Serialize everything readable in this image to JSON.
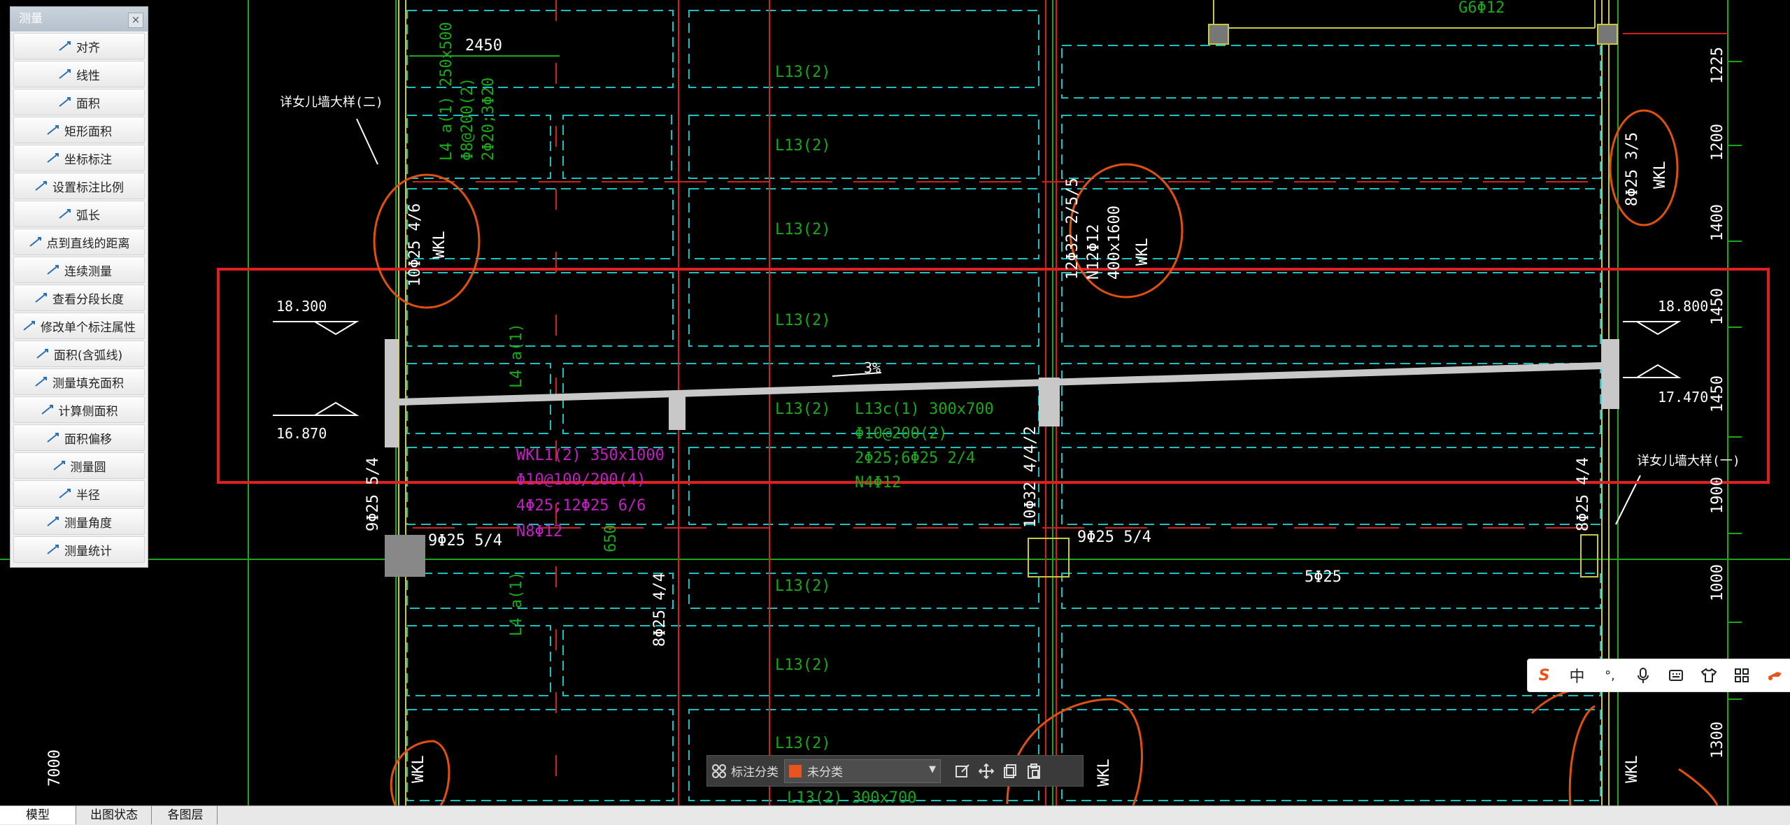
{
  "panel": {
    "title": "测量",
    "close": "×",
    "tools": [
      {
        "label": "对齐",
        "icon": "align-icon"
      },
      {
        "label": "线性",
        "icon": "linear-icon"
      },
      {
        "label": "面积",
        "icon": "area-icon"
      },
      {
        "label": "矩形面积",
        "icon": "rect-area-icon"
      },
      {
        "label": "坐标标注",
        "icon": "coordinate-icon"
      },
      {
        "label": "设置标注比例",
        "icon": "scale-icon"
      },
      {
        "label": "弧长",
        "icon": "arc-icon"
      },
      {
        "label": "点到直线的距离",
        "icon": "point-line-icon"
      },
      {
        "label": "连续测量",
        "icon": "continuous-icon"
      },
      {
        "label": "查看分段长度",
        "icon": "segment-icon"
      },
      {
        "label": "修改单个标注属性",
        "icon": "edit-dim-icon"
      },
      {
        "label": "面积(含弧线)",
        "icon": "arc-area-icon"
      },
      {
        "label": "测量填充面积",
        "icon": "fill-area-icon"
      },
      {
        "label": "计算侧面积",
        "icon": "side-area-icon"
      },
      {
        "label": "面积偏移",
        "icon": "offset-icon"
      },
      {
        "label": "测量圆",
        "icon": "circle-icon"
      },
      {
        "label": "半径",
        "icon": "radius-icon"
      },
      {
        "label": "测量角度",
        "icon": "angle-icon"
      },
      {
        "label": "测量统计",
        "icon": "stats-icon"
      }
    ]
  },
  "tabs": [
    {
      "label": "模型",
      "active": true
    },
    {
      "label": "出图状态",
      "active": false
    },
    {
      "label": "各图层",
      "active": false
    }
  ],
  "annotation_bar": {
    "category_label": "标注分类",
    "category_value": "未分类",
    "swatch_color": "#e8541c"
  },
  "ime": {
    "items": [
      "S",
      "中",
      "°,",
      "mic",
      "kbd",
      "shirt",
      "grid",
      "tool"
    ]
  },
  "drawing": {
    "top_dim": "2450",
    "detail_left": "详女儿墙大样(二)",
    "detail_right": "详女儿墙大样(一)",
    "beam_L4a": [
      "L4 a(1) 250x500",
      "Φ8@200(2)",
      "2Φ20;3Φ20"
    ],
    "L13_labels": [
      "L13(2)",
      "L13(2)",
      "L13(2)",
      "L13(2)",
      "L13(2)",
      "L13(2)",
      "L13(2)",
      "L13(2)"
    ],
    "L4a_short": [
      "L4 a(1)",
      "L4 a(1)"
    ],
    "wkl_left": "10Φ25 4/6",
    "wkl_center": [
      "12Φ32 2/5/5",
      "N12Φ12",
      "400x1600"
    ],
    "wkl_right": "8Φ25 3/5",
    "wkl_word": "WKL",
    "elev_left_top": "18.300",
    "elev_left_bot": "16.870",
    "elev_right_top": "18.800",
    "elev_right_bot": "17.470",
    "slope": "3%",
    "L13c": [
      "L13c(1) 300x700",
      "Φ10@200(2)",
      "2Φ25;6Φ25 2/4",
      "N4Φ12"
    ],
    "wkl1": [
      "WKL1(2) 350x1000",
      "Φ10@100/200(4)",
      "4Φ25;12Φ25 6/6",
      "N8Φ12"
    ],
    "col_left_text": "9Φ25 5/4",
    "col_left_label": "9Φ25 5/4",
    "col_mid_text": "10Φ32 4/4/2",
    "col_mid_label": "9Φ25 5/4",
    "col_right_text": "8Φ25 4/4",
    "mid_rebar": "5Φ25",
    "lower_rebar": "8Φ25 4/4",
    "bottom_beam": "L13(2) 300x700",
    "dim_650": "650",
    "top_right_rebar": "G6Φ12",
    "right_dims": [
      "1225",
      "1200",
      "1400",
      "1450",
      "1450",
      "1900",
      "1000",
      "1300"
    ],
    "left_dim": "7000"
  }
}
